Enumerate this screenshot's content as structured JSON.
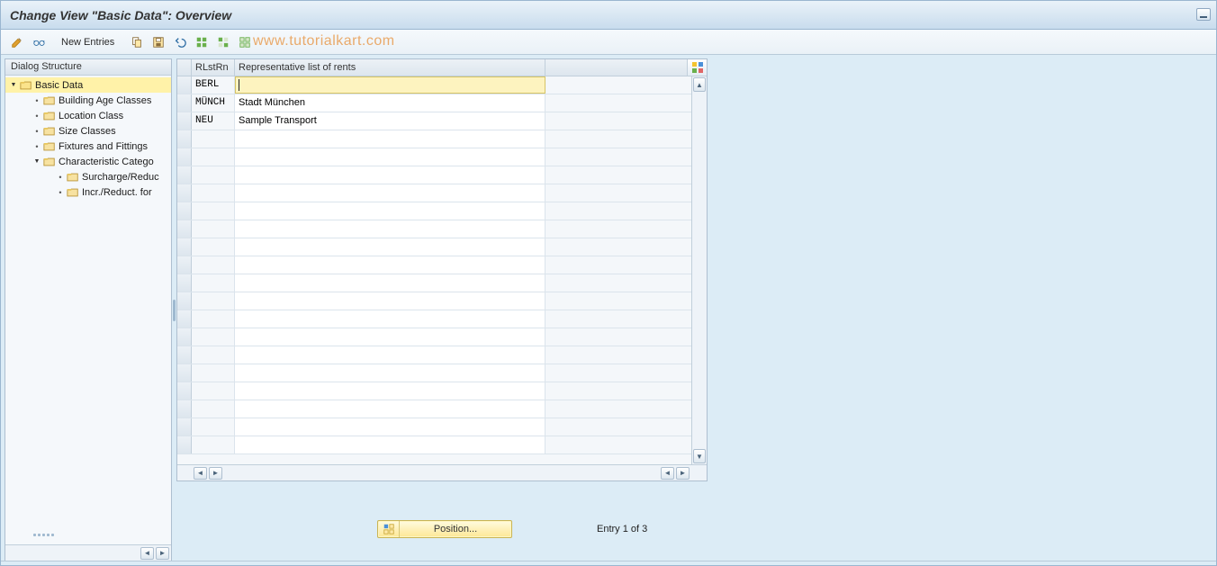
{
  "title": "Change View \"Basic Data\": Overview",
  "toolbar": {
    "new_entries_label": "New Entries",
    "icons": {
      "change": "pencil-icon",
      "other_view": "glasses-icon",
      "copy": "copy-icon",
      "save": "save-icon",
      "undo": "undo-icon",
      "select_all": "select-all-icon",
      "select_block": "select-block-icon",
      "deselect_all": "deselect-all-icon"
    }
  },
  "watermark": "www.tutorialkart.com",
  "tree": {
    "header": "Dialog Structure",
    "nodes": [
      {
        "label": "Basic Data",
        "level": 0,
        "state": "open",
        "open_folder": true,
        "selected": true
      },
      {
        "label": "Building Age Classes",
        "level": 1,
        "state": "leaf"
      },
      {
        "label": "Location Class",
        "level": 1,
        "state": "leaf"
      },
      {
        "label": "Size Classes",
        "level": 1,
        "state": "leaf"
      },
      {
        "label": "Fixtures and Fittings",
        "level": 1,
        "state": "leaf"
      },
      {
        "label": "Characteristic Catego",
        "level": 1,
        "state": "open"
      },
      {
        "label": "Surcharge/Reduc",
        "level": 2,
        "state": "leaf"
      },
      {
        "label": "Incr./Reduct. for",
        "level": 2,
        "state": "leaf"
      }
    ]
  },
  "grid": {
    "columns": {
      "a": "RLstRn",
      "b": "Representative list of rents"
    },
    "rows": [
      {
        "a": "BERL",
        "b": "",
        "active": true
      },
      {
        "a": "MÜNCH",
        "b": "Stadt München"
      },
      {
        "a": "NEU",
        "b": "Sample Transport"
      }
    ],
    "empty_rows": 18
  },
  "footer": {
    "position_label": "Position...",
    "entry_status": "Entry 1 of 3"
  }
}
